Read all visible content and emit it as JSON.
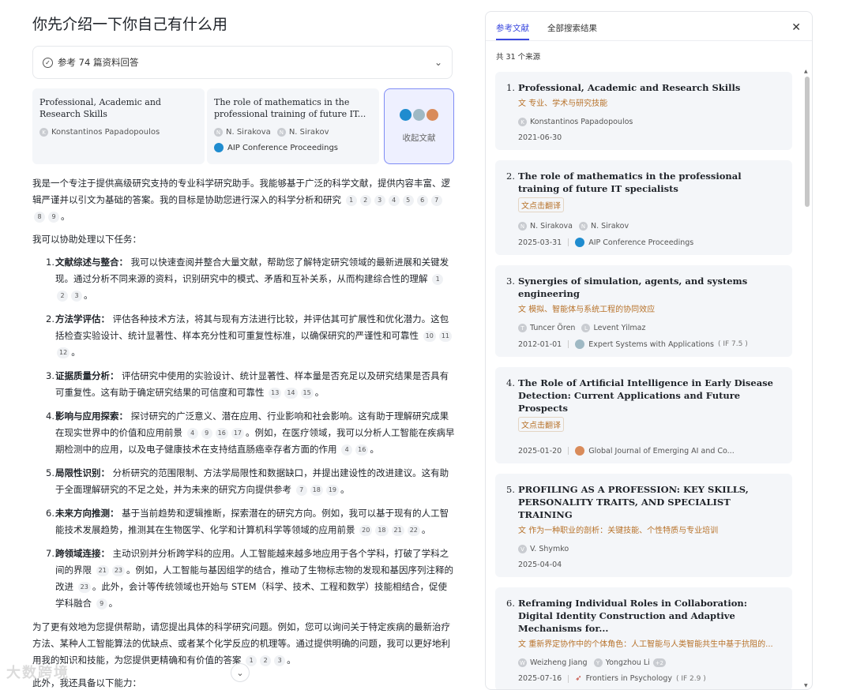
{
  "question": "你先介绍一下你自己有什么用",
  "refs_bar": {
    "label": "参考 74 篇资料回答"
  },
  "cards": [
    {
      "title": "Professional, Academic and Research Skills",
      "authors": [
        {
          "initial": "K",
          "name": "Konstantinos Papadopoulos"
        }
      ],
      "journal": ""
    },
    {
      "title": "The role of mathematics in the professional training of future IT...",
      "authors": [
        {
          "initial": "N",
          "name": "N. Sirakova"
        },
        {
          "initial": "N",
          "name": "N. Sirakov"
        }
      ],
      "journal": "AIP Conference Proceedings"
    }
  ],
  "collect_label": "收起文献",
  "answer": {
    "intro": "我是一个专注于提供高级研究支持的专业科学研究助手。我能够基于广泛的科学文献，提供内容丰富、逻辑严谨并以引文为基础的答案。我的目标是协助您进行深入的科学分析和研究",
    "intro_cites": [
      "1",
      "2",
      "3",
      "4",
      "5",
      "6",
      "7",
      "8",
      "9"
    ],
    "tasks_heading": "我可以协助处理以下任务：",
    "tasks": [
      {
        "num": "1.",
        "title": "文献综述与整合：",
        "text": "我可以快速查阅并整合大量文献，帮助您了解特定研究领域的最新进展和关键发现。通过分析不同来源的资料，识别研究中的模式、矛盾和互补关系，从而构建综合性的理解",
        "cites": [
          "1",
          "2",
          "3"
        ]
      },
      {
        "num": "2.",
        "title": "方法学评估：",
        "text": "评估各种技术方法，将其与现有方法进行比较，并评估其可扩展性和优化潜力。这包括检查实验设计、统计显著性、样本充分性和可重复性标准，以确保研究的严谨性和可靠性",
        "cites": [
          "10",
          "11",
          "12"
        ]
      },
      {
        "num": "3.",
        "title": "证据质量分析：",
        "text": "评估研究中使用的实验设计、统计显著性、样本量是否充足以及研究结果是否具有可重复性。这有助于确定研究结果的可信度和可靠性",
        "cites": [
          "13",
          "14",
          "15"
        ]
      },
      {
        "num": "4.",
        "title": "影响与应用探索：",
        "text": "探讨研究的广泛意义、潜在应用、行业影响和社会影响。这有助于理解研究成果在现实世界中的价值和应用前景",
        "cites": [
          "4",
          "9",
          "16",
          "17"
        ],
        "text2": "。例如，在医疗领域，我可以分析人工智能在疾病早期检测中的应用，以及电子健康技术在支持结直肠癌幸存者方面的作用",
        "cites2": [
          "4",
          "16"
        ]
      },
      {
        "num": "5.",
        "title": "局限性识别：",
        "text": "分析研究的范围限制、方法学局限性和数据缺口，并提出建设性的改进建议。这有助于全面理解研究的不足之处，并为未来的研究方向提供参考",
        "cites": [
          "7",
          "18",
          "19"
        ]
      },
      {
        "num": "6.",
        "title": "未来方向推测：",
        "text": "基于当前趋势和逻辑推断，探索潜在的研究方向。例如，我可以基于现有的人工智能技术发展趋势，推测其在生物医学、化学和计算机科学等领域的应用前景",
        "cites": [
          "20",
          "18",
          "21",
          "22"
        ]
      },
      {
        "num": "7.",
        "title": "跨领域连接：",
        "text": "主动识别并分析跨学科的应用。人工智能越来越多地应用于各个学科，打破了学科之间的界限",
        "cites": [
          "21",
          "23"
        ],
        "text2": "。例如，人工智能与基因组学的结合，推动了生物标志物的发现和基因序列注释的改进",
        "cites2": [
          "23"
        ],
        "text3": "。此外，会计等传统领域也开始与 STEM（科学、技术、工程和数学）技能相结合，促使学科融合",
        "cites3": [
          "9"
        ]
      }
    ],
    "outro": "为了更有效地为您提供帮助，请您提出具体的科学研究问题。例如，您可以询问关于特定疾病的最新治疗方法、某种人工智能算法的优缺点、或者某个化学反应的机理等。通过提供明确的问题，我可以更好地利用我的知识和技能，为您提供更精确和有价值的答案",
    "outro_cites": [
      "1",
      "2",
      "3"
    ],
    "tail": "此外，我还具备以下能力："
  },
  "watermark": "大数跨境",
  "panel": {
    "tabs": [
      "参考文献",
      "全部搜索结果"
    ],
    "count": "共 31 个来源",
    "items": [
      {
        "n": "1.",
        "title": "Professional, Academic and Research Skills",
        "sub": "专业、学术与研究技能",
        "translate": "",
        "authors": [
          {
            "initial": "K",
            "name": "Konstantinos Papadopoulos"
          }
        ],
        "date": "2021-06-30",
        "journal": "",
        "if": ""
      },
      {
        "n": "2.",
        "title": "The role of mathematics in the professional training of future IT specialists",
        "sub": "",
        "translate": "点击翻译",
        "authors": [
          {
            "initial": "N",
            "name": "N. Sirakova"
          },
          {
            "initial": "N",
            "name": "N. Sirakov"
          }
        ],
        "date": "2025-03-31",
        "journal": "AIP Conference Proceedings",
        "if": ""
      },
      {
        "n": "3.",
        "title": "Synergies of simulation, agents, and systems engineering",
        "sub": "模拟、智能体与系统工程的协同效应",
        "translate": "",
        "authors": [
          {
            "initial": "T",
            "name": "Tuncer Ören"
          },
          {
            "initial": "L",
            "name": "Levent Yilmaz"
          }
        ],
        "date": "2012-01-01",
        "journal": "Expert Systems with Applications",
        "if": "( IF 7.5 )"
      },
      {
        "n": "4.",
        "title": "The Role of Artificial Intelligence in Early Disease Detection: Current Applications and Future Prospects",
        "sub": "",
        "translate": "点击翻译",
        "authors": [],
        "date": "2025-01-20",
        "journal": "Global Journal of Emerging AI and Co...",
        "if": ""
      },
      {
        "n": "5.",
        "title": "PROFILING AS A PROFESSION: KEY SKILLS, PERSONALITY TRAITS, AND SPECIALIST TRAINING",
        "sub": "作为一种职业的剖析：关键技能、个性特质与专业培训",
        "translate": "",
        "authors": [
          {
            "initial": "V",
            "name": "V. Shymko"
          }
        ],
        "date": "2025-04-04",
        "journal": "",
        "if": ""
      },
      {
        "n": "6.",
        "title": "Reframing Individual Roles in Collaboration: Digital Identity Construction and Adaptive Mechanisms for...",
        "sub": "重新界定协作中的个体角色：人工智能与人类智能共生中基于抗阻的...",
        "translate": "",
        "authors": [
          {
            "initial": "W",
            "name": "Weizheng Jiang"
          },
          {
            "initial": "Y",
            "name": "Yongzhou Li"
          },
          {
            "initial": "+2",
            "name": ""
          }
        ],
        "date": "2025-07-16",
        "journal": "Frontiers in Psychology",
        "if": "( IF 2.9 )"
      }
    ]
  },
  "colors": {
    "accent": "#3b49df",
    "translate": "#b7722a",
    "card_bg": "#f4f6f9"
  }
}
